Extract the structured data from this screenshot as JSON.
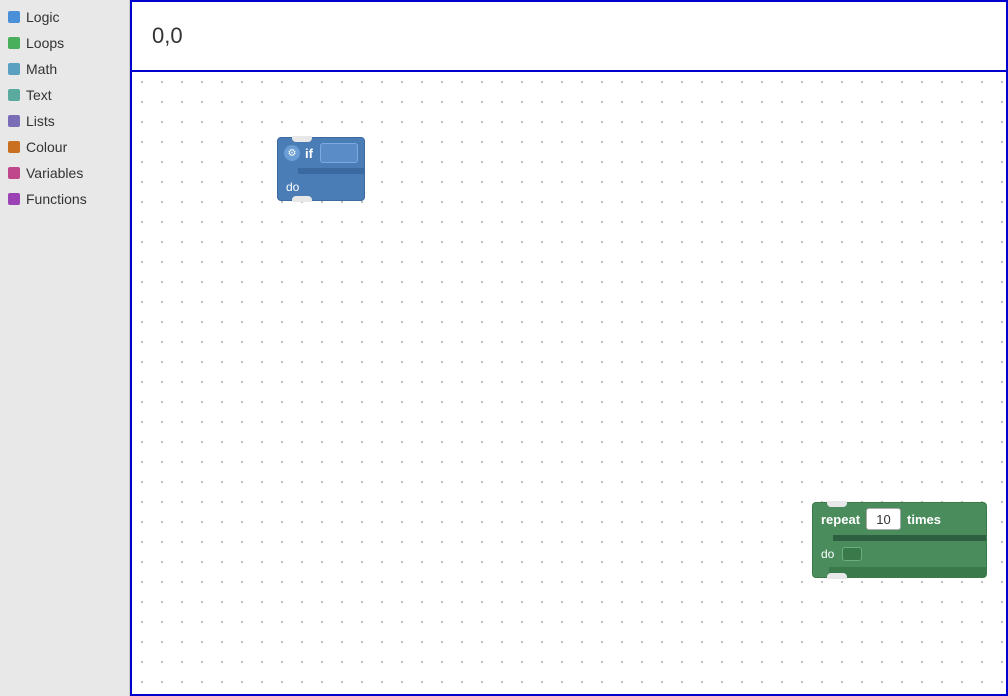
{
  "sidebar": {
    "items": [
      {
        "id": "logic",
        "label": "Logic",
        "color": "#4a90d9"
      },
      {
        "id": "loops",
        "label": "Loops",
        "color": "#4aaf5c"
      },
      {
        "id": "math",
        "label": "Math",
        "color": "#5ba0c0"
      },
      {
        "id": "text",
        "label": "Text",
        "color": "#5baaa0"
      },
      {
        "id": "lists",
        "label": "Lists",
        "color": "#7a6cb5"
      },
      {
        "id": "colour",
        "label": "Colour",
        "color": "#c87020"
      },
      {
        "id": "variables",
        "label": "Variables",
        "color": "#c0478a"
      },
      {
        "id": "functions",
        "label": "Functions",
        "color": "#9b42b5"
      }
    ]
  },
  "coord_bar": {
    "coords": "0,0"
  },
  "if_block": {
    "if_label": "if",
    "do_label": "do"
  },
  "repeat_block": {
    "repeat_label": "repeat",
    "times_label": "times",
    "do_label": "do",
    "count": "10"
  }
}
